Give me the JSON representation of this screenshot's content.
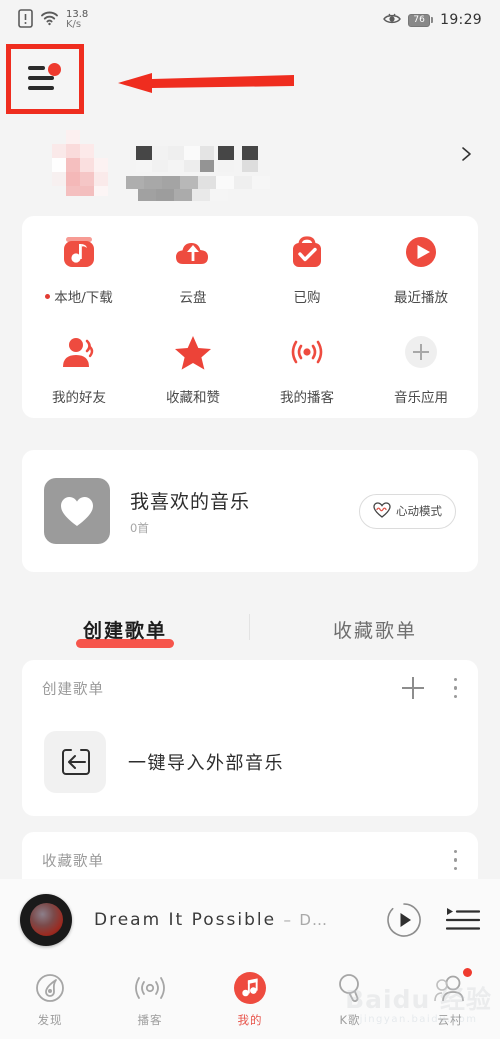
{
  "status_bar": {
    "net_speed_value": "13.8",
    "net_speed_unit": "K/s",
    "battery": "76",
    "time": "19:29",
    "sim_icon": "sim-card-icon",
    "wifi_icon": "wifi-icon",
    "eye_icon": "eye-care-icon"
  },
  "header": {
    "menu_icon": "hamburger-menu-icon",
    "menu_has_badge": true,
    "annotation_box_color": "#ef2d1f",
    "annotation_arrow_color": "#ef2d1f",
    "profile_chevron_icon": "chevron-right-icon",
    "profile_blurred": true
  },
  "quick_grid": [
    {
      "icon": "local-download-icon",
      "label": "本地/下载",
      "badge": true
    },
    {
      "icon": "cloud-disk-icon",
      "label": "云盘",
      "badge": false
    },
    {
      "icon": "purchased-bag-icon",
      "label": "已购",
      "badge": false
    },
    {
      "icon": "recent-play-icon",
      "label": "最近播放",
      "badge": false
    },
    {
      "icon": "my-friends-icon",
      "label": "我的好友",
      "badge": false
    },
    {
      "icon": "star-favorites-icon",
      "label": "收藏和赞",
      "badge": false
    },
    {
      "icon": "podcast-icon",
      "label": "我的播客",
      "badge": false
    },
    {
      "icon": "add-music-app-icon",
      "label": "音乐应用",
      "badge": false
    }
  ],
  "favorites": {
    "cover_icon": "heart-icon",
    "title": "我喜欢的音乐",
    "count": "0首",
    "heart_mode_label": "心动模式",
    "heart_mode_icon": "heartbeat-icon"
  },
  "tabs": [
    {
      "label": "创建歌单",
      "active": true
    },
    {
      "label": "收藏歌单",
      "active": false
    }
  ],
  "created_section": {
    "title": "创建歌单",
    "add_icon": "plus-icon",
    "more_icon": "more-vertical-icon",
    "import_row": {
      "icon": "import-arrow-icon",
      "label": "一键导入外部音乐"
    }
  },
  "collected_section": {
    "title": "收藏歌单",
    "more_icon": "more-vertical-icon"
  },
  "player": {
    "cover_icon": "album-disc-icon",
    "title": "Dream It Possible",
    "separator": "–",
    "artist": "D…",
    "play_icon": "play-icon",
    "playlist_icon": "playlist-icon"
  },
  "bottom_nav": [
    {
      "icon": "discover-icon",
      "label": "发现",
      "active": false,
      "badge": false
    },
    {
      "icon": "podcast-nav-icon",
      "label": "播客",
      "active": false,
      "badge": false
    },
    {
      "icon": "mine-music-icon",
      "label": "我的",
      "active": true,
      "badge": false
    },
    {
      "icon": "karaoke-icon",
      "label": "K歌",
      "active": false,
      "badge": false
    },
    {
      "icon": "cloud-village-icon",
      "label": "云村",
      "active": false,
      "badge": true
    }
  ],
  "watermark": {
    "main": "Baidu 经验",
    "sub": "jingyan.baidu.com"
  },
  "colors": {
    "accent_red": "#ef3b2f",
    "page_bg": "#f4f4f4",
    "card_bg": "#ffffff"
  }
}
